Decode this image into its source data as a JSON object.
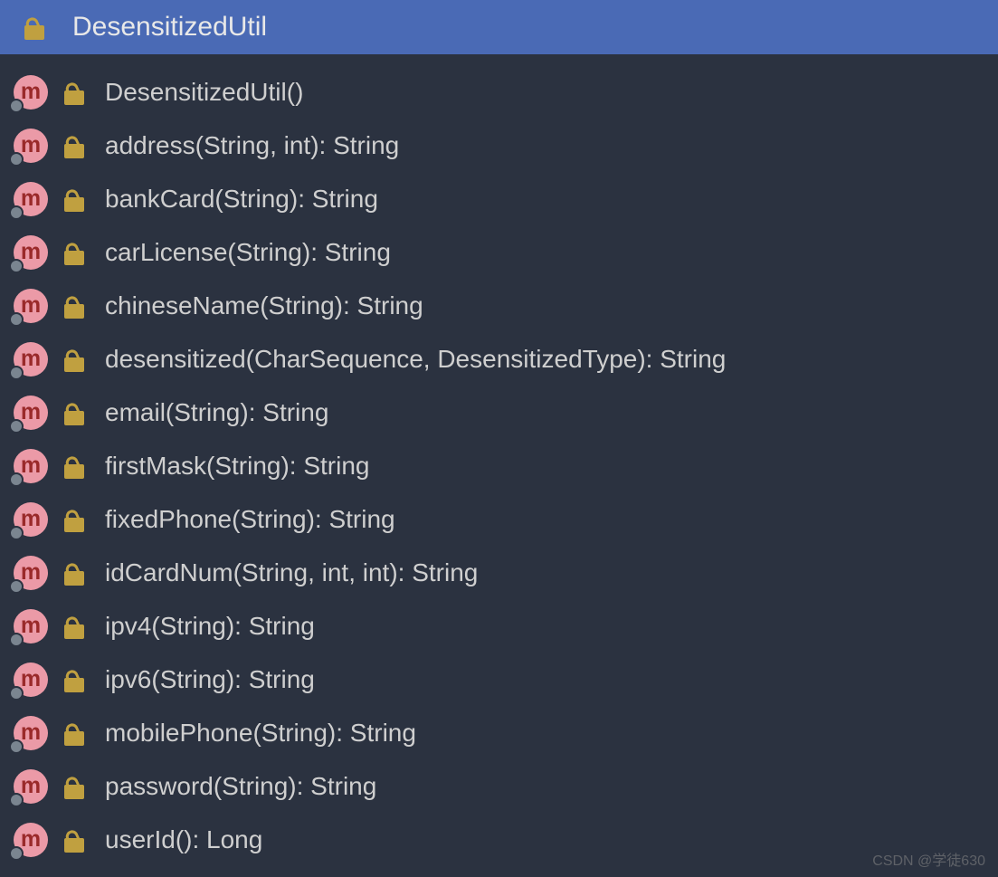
{
  "header": {
    "title": "DesensitizedUtil",
    "lock_color": "#c0a040"
  },
  "method_icon_letter": "m",
  "methods": [
    {
      "signature": "DesensitizedUtil()"
    },
    {
      "signature": "address(String, int): String"
    },
    {
      "signature": "bankCard(String): String"
    },
    {
      "signature": "carLicense(String): String"
    },
    {
      "signature": "chineseName(String): String"
    },
    {
      "signature": "desensitized(CharSequence, DesensitizedType): String"
    },
    {
      "signature": "email(String): String"
    },
    {
      "signature": "firstMask(String): String"
    },
    {
      "signature": "fixedPhone(String): String"
    },
    {
      "signature": "idCardNum(String, int, int): String"
    },
    {
      "signature": "ipv4(String): String"
    },
    {
      "signature": "ipv6(String): String"
    },
    {
      "signature": "mobilePhone(String): String"
    },
    {
      "signature": "password(String): String"
    },
    {
      "signature": "userId(): Long"
    }
  ],
  "watermark": "CSDN @学徒630"
}
